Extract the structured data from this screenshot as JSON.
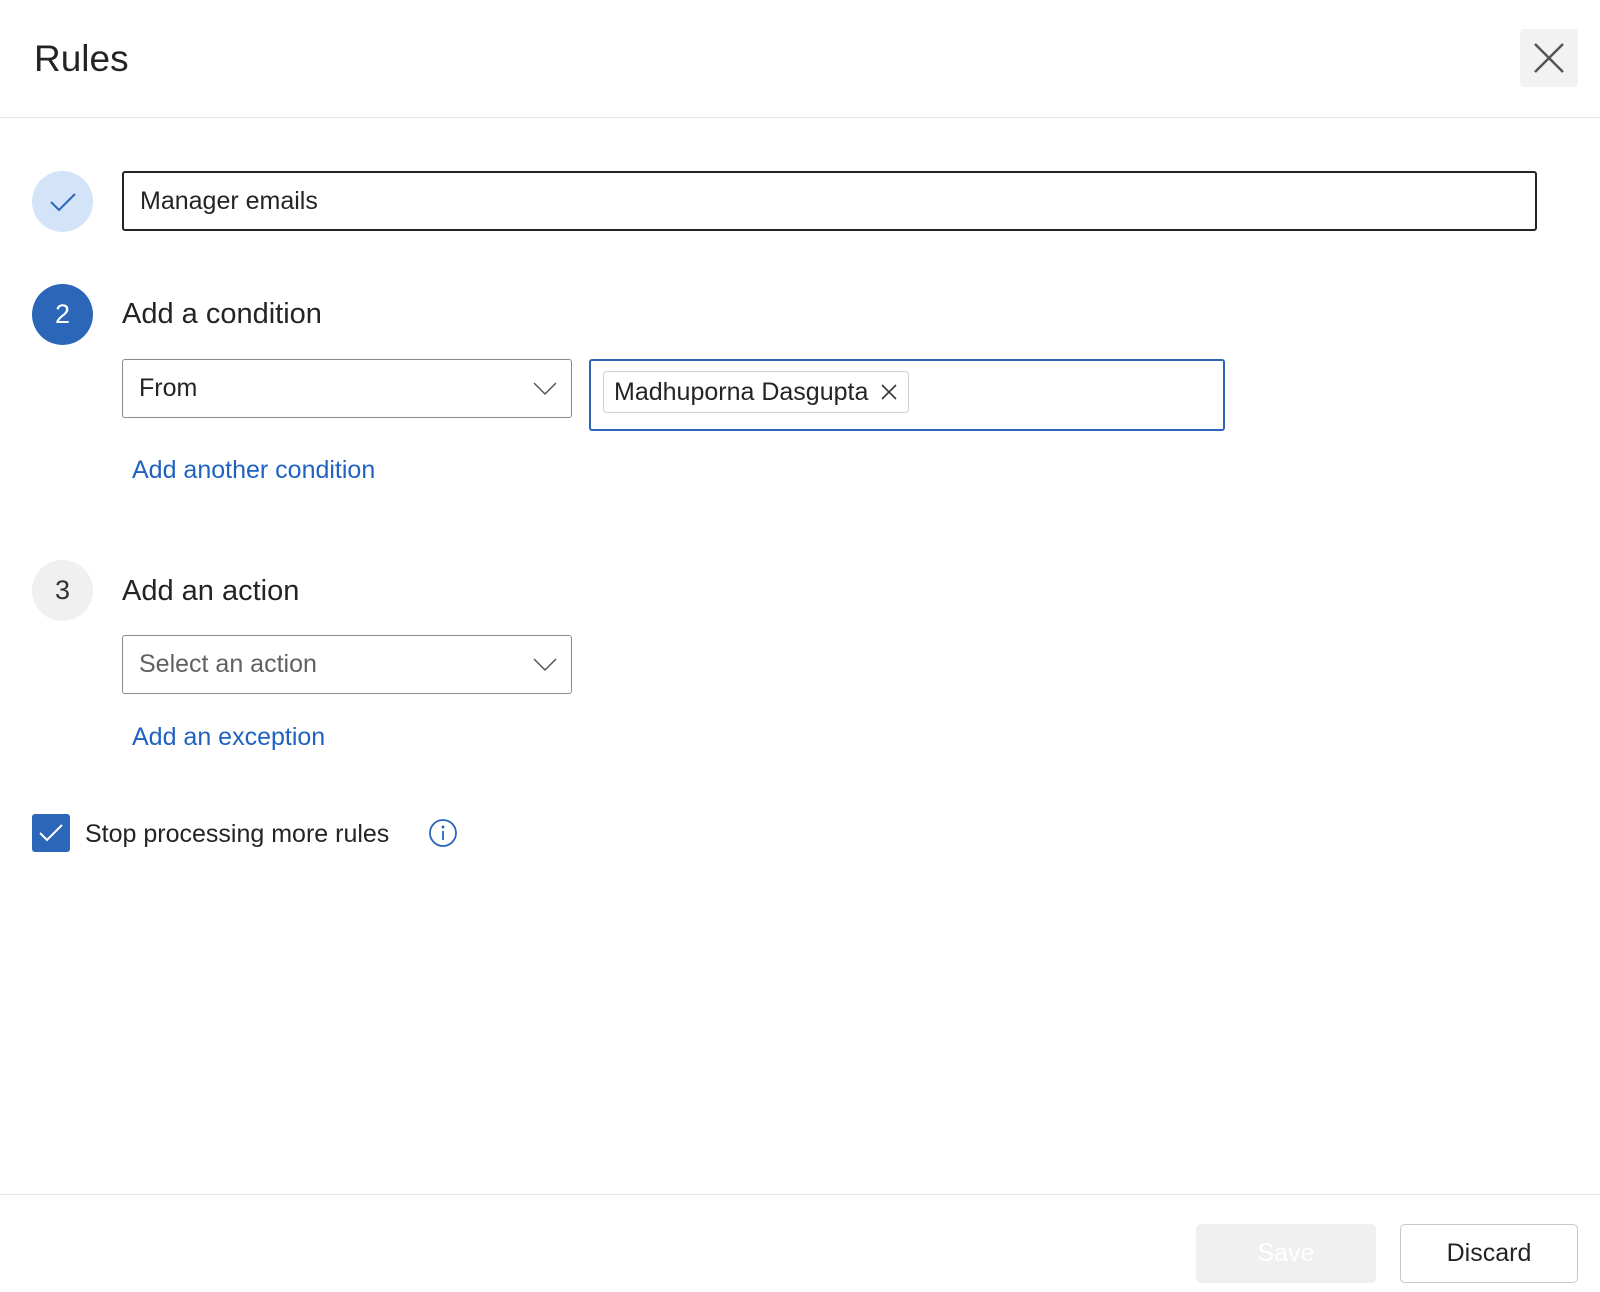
{
  "header": {
    "title": "Rules",
    "close_icon": "close-icon"
  },
  "step1": {
    "status_icon": "checkmark-icon",
    "rule_name": "Manager emails"
  },
  "step2": {
    "number": "2",
    "heading": "Add a condition",
    "condition_type": "From",
    "recipient_chip": "Madhuporna Dasgupta",
    "add_condition_link": "Add another condition"
  },
  "step3": {
    "number": "3",
    "heading": "Add an action",
    "action_placeholder": "Select an action",
    "add_exception_link": "Add an exception"
  },
  "stop_processing": {
    "label": "Stop processing more rules",
    "checked": true,
    "info_icon": "info-icon"
  },
  "footer": {
    "save_label": "Save",
    "discard_label": "Discard"
  },
  "colors": {
    "accent": "#2b66b8",
    "step_done_bg": "#d3e3f8",
    "link": "#1f62c2"
  }
}
